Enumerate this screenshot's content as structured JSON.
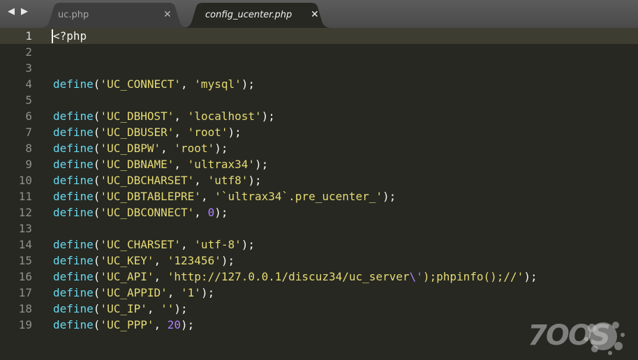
{
  "nav": {
    "back_icon": "◀",
    "forward_icon": "▶"
  },
  "tabs": [
    {
      "label": "uc.php",
      "close": "✕",
      "active": false
    },
    {
      "label": "config_ucenter.php",
      "close": "✕",
      "active": true
    }
  ],
  "editor": {
    "current_line": 1,
    "lines": [
      {
        "num": "1",
        "tokens": [
          {
            "t": "<?php",
            "c": "#f8f8f2"
          }
        ]
      },
      {
        "num": "2",
        "tokens": []
      },
      {
        "num": "3",
        "tokens": []
      },
      {
        "num": "4",
        "tokens": [
          {
            "t": "define",
            "c": "#66d9ef"
          },
          {
            "t": "(",
            "c": "#f8f8f2"
          },
          {
            "t": "'UC_CONNECT'",
            "c": "#e6db74"
          },
          {
            "t": ", ",
            "c": "#f8f8f2"
          },
          {
            "t": "'mysql'",
            "c": "#e6db74"
          },
          {
            "t": ");",
            "c": "#f8f8f2"
          }
        ]
      },
      {
        "num": "5",
        "tokens": []
      },
      {
        "num": "6",
        "tokens": [
          {
            "t": "define",
            "c": "#66d9ef"
          },
          {
            "t": "(",
            "c": "#f8f8f2"
          },
          {
            "t": "'UC_DBHOST'",
            "c": "#e6db74"
          },
          {
            "t": ", ",
            "c": "#f8f8f2"
          },
          {
            "t": "'localhost'",
            "c": "#e6db74"
          },
          {
            "t": ");",
            "c": "#f8f8f2"
          }
        ]
      },
      {
        "num": "7",
        "tokens": [
          {
            "t": "define",
            "c": "#66d9ef"
          },
          {
            "t": "(",
            "c": "#f8f8f2"
          },
          {
            "t": "'UC_DBUSER'",
            "c": "#e6db74"
          },
          {
            "t": ", ",
            "c": "#f8f8f2"
          },
          {
            "t": "'root'",
            "c": "#e6db74"
          },
          {
            "t": ");",
            "c": "#f8f8f2"
          }
        ]
      },
      {
        "num": "8",
        "tokens": [
          {
            "t": "define",
            "c": "#66d9ef"
          },
          {
            "t": "(",
            "c": "#f8f8f2"
          },
          {
            "t": "'UC_DBPW'",
            "c": "#e6db74"
          },
          {
            "t": ", ",
            "c": "#f8f8f2"
          },
          {
            "t": "'root'",
            "c": "#e6db74"
          },
          {
            "t": ");",
            "c": "#f8f8f2"
          }
        ]
      },
      {
        "num": "9",
        "tokens": [
          {
            "t": "define",
            "c": "#66d9ef"
          },
          {
            "t": "(",
            "c": "#f8f8f2"
          },
          {
            "t": "'UC_DBNAME'",
            "c": "#e6db74"
          },
          {
            "t": ", ",
            "c": "#f8f8f2"
          },
          {
            "t": "'ultrax34'",
            "c": "#e6db74"
          },
          {
            "t": ");",
            "c": "#f8f8f2"
          }
        ]
      },
      {
        "num": "10",
        "tokens": [
          {
            "t": "define",
            "c": "#66d9ef"
          },
          {
            "t": "(",
            "c": "#f8f8f2"
          },
          {
            "t": "'UC_DBCHARSET'",
            "c": "#e6db74"
          },
          {
            "t": ", ",
            "c": "#f8f8f2"
          },
          {
            "t": "'utf8'",
            "c": "#e6db74"
          },
          {
            "t": ");",
            "c": "#f8f8f2"
          }
        ]
      },
      {
        "num": "11",
        "tokens": [
          {
            "t": "define",
            "c": "#66d9ef"
          },
          {
            "t": "(",
            "c": "#f8f8f2"
          },
          {
            "t": "'UC_DBTABLEPRE'",
            "c": "#e6db74"
          },
          {
            "t": ", ",
            "c": "#f8f8f2"
          },
          {
            "t": "'`ultrax34`.pre_ucenter_'",
            "c": "#e6db74"
          },
          {
            "t": ");",
            "c": "#f8f8f2"
          }
        ]
      },
      {
        "num": "12",
        "tokens": [
          {
            "t": "define",
            "c": "#66d9ef"
          },
          {
            "t": "(",
            "c": "#f8f8f2"
          },
          {
            "t": "'UC_DBCONNECT'",
            "c": "#e6db74"
          },
          {
            "t": ", ",
            "c": "#f8f8f2"
          },
          {
            "t": "0",
            "c": "#ae81ff"
          },
          {
            "t": ");",
            "c": "#f8f8f2"
          }
        ]
      },
      {
        "num": "13",
        "tokens": []
      },
      {
        "num": "14",
        "tokens": [
          {
            "t": "define",
            "c": "#66d9ef"
          },
          {
            "t": "(",
            "c": "#f8f8f2"
          },
          {
            "t": "'UC_CHARSET'",
            "c": "#e6db74"
          },
          {
            "t": ", ",
            "c": "#f8f8f2"
          },
          {
            "t": "'utf-8'",
            "c": "#e6db74"
          },
          {
            "t": ");",
            "c": "#f8f8f2"
          }
        ]
      },
      {
        "num": "15",
        "tokens": [
          {
            "t": "define",
            "c": "#66d9ef"
          },
          {
            "t": "(",
            "c": "#f8f8f2"
          },
          {
            "t": "'UC_KEY'",
            "c": "#e6db74"
          },
          {
            "t": ", ",
            "c": "#f8f8f2"
          },
          {
            "t": "'123456'",
            "c": "#e6db74"
          },
          {
            "t": ");",
            "c": "#f8f8f2"
          }
        ]
      },
      {
        "num": "16",
        "tokens": [
          {
            "t": "define",
            "c": "#66d9ef"
          },
          {
            "t": "(",
            "c": "#f8f8f2"
          },
          {
            "t": "'UC_API'",
            "c": "#e6db74"
          },
          {
            "t": ", ",
            "c": "#f8f8f2"
          },
          {
            "t": "'http://127.0.0.1/discuz34/uc_server",
            "c": "#e6db74"
          },
          {
            "t": "\\'",
            "c": "#ae81ff"
          },
          {
            "t": ");phpinfo();//'",
            "c": "#e6db74"
          },
          {
            "t": ");",
            "c": "#f8f8f2"
          }
        ]
      },
      {
        "num": "17",
        "tokens": [
          {
            "t": "define",
            "c": "#66d9ef"
          },
          {
            "t": "(",
            "c": "#f8f8f2"
          },
          {
            "t": "'UC_APPID'",
            "c": "#e6db74"
          },
          {
            "t": ", ",
            "c": "#f8f8f2"
          },
          {
            "t": "'1'",
            "c": "#e6db74"
          },
          {
            "t": ");",
            "c": "#f8f8f2"
          }
        ]
      },
      {
        "num": "18",
        "tokens": [
          {
            "t": "define",
            "c": "#66d9ef"
          },
          {
            "t": "(",
            "c": "#f8f8f2"
          },
          {
            "t": "'UC_IP'",
            "c": "#e6db74"
          },
          {
            "t": ", ",
            "c": "#f8f8f2"
          },
          {
            "t": "''",
            "c": "#e6db74"
          },
          {
            "t": ");",
            "c": "#f8f8f2"
          }
        ]
      },
      {
        "num": "19",
        "tokens": [
          {
            "t": "define",
            "c": "#66d9ef"
          },
          {
            "t": "(",
            "c": "#f8f8f2"
          },
          {
            "t": "'UC_PPP'",
            "c": "#e6db74"
          },
          {
            "t": ", ",
            "c": "#f8f8f2"
          },
          {
            "t": "20",
            "c": "#ae81ff"
          },
          {
            "t": ");",
            "c": "#f8f8f2"
          }
        ]
      }
    ]
  },
  "watermark": {
    "text": "7OOS"
  },
  "colors": {
    "editor_bg": "#272822",
    "current_line_bg": "#3e3d32",
    "tabbar_bg": "#575757",
    "active_tab_bg": "#272822",
    "inactive_tab_bg": "#3d3d3d"
  }
}
